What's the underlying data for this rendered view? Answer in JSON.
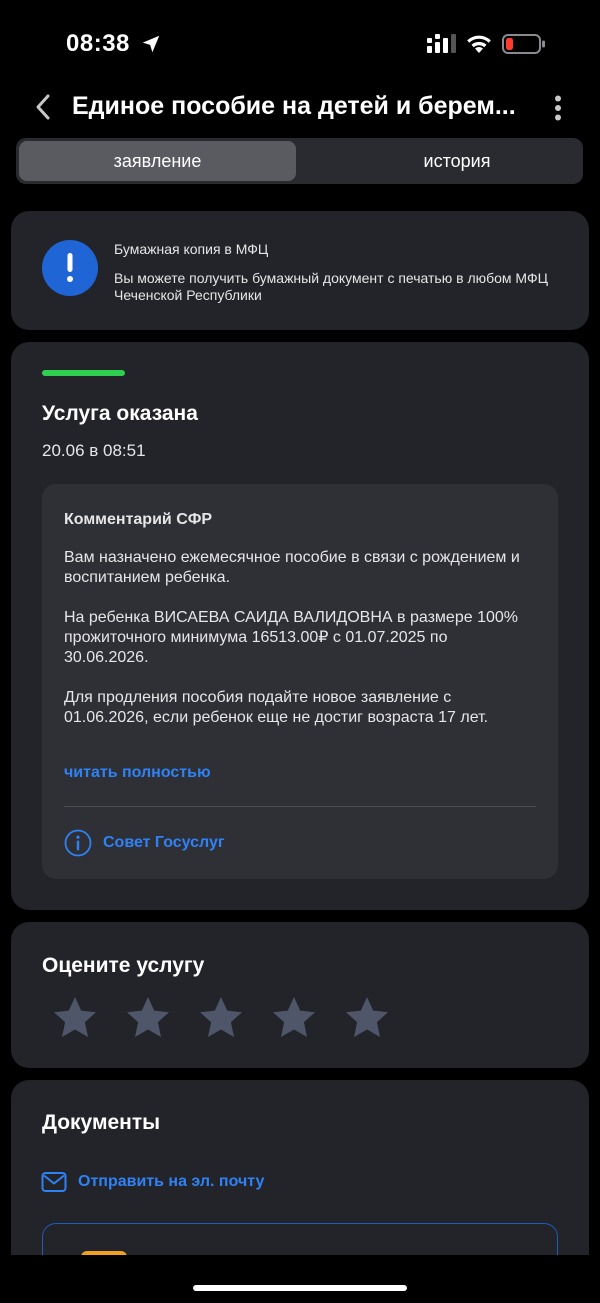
{
  "status_bar": {
    "time": "08:38"
  },
  "header": {
    "title": "Единое пособие на детей и берем..."
  },
  "tabs": [
    {
      "label": "заявление",
      "active": true
    },
    {
      "label": "история",
      "active": false
    }
  ],
  "info": {
    "title": "Бумажная копия в МФЦ",
    "text": "Вы можете получить бумажный документ с печатью в любом МФЦ Чеченской Республики"
  },
  "status": {
    "title": "Услуга оказана",
    "date": "20.06 в 08:51",
    "accent": "#2fd04f"
  },
  "comment": {
    "title": "Комментарий СФР",
    "p1": "Вам назначено ежемесячное пособие в связи с рождением и воспитанием ребенка.",
    "p2": "На ребенка ВИСАЕВА САИДА ВАЛИДОВНА в размере 100% прожиточного минимума 16513.00₽ с 01.07.2025 по 30.06.2026.",
    "p3": "Для продления пособия подайте новое заявление с 01.06.2026, если ребенок еще не достиг возраста 17 лет.",
    "read_more": "читать полностью",
    "advice_label": "Совет Госуслуг"
  },
  "rating": {
    "title": "Оцените услугу",
    "stars": 0,
    "max_stars": 5
  },
  "documents": {
    "title": "Документы",
    "email_label": "Отправить на эл. почту"
  },
  "colors": {
    "accent_blue": "#2f82f5",
    "card_bg": "#232429",
    "info_icon_bg": "#1f65d6",
    "star_inactive": "#4f5669"
  }
}
